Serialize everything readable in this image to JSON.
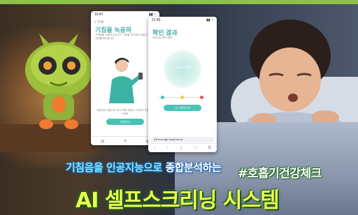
{
  "phone1": {
    "time": "10:47",
    "back_label": "< 뒤로",
    "title": "기침을 녹음하",
    "description": "기침음을 녹음하시면 AI가 기침을 분석하여 호흡기 건강 상태를 확인합니다.",
    "hint": "녹음버튼이 빨간색 으로 바뀌면 녹음이 시작되며 기침을 해주세요.",
    "button_label": "녹음하기"
  },
  "phone2": {
    "time": "21:45",
    "title": "확인 결과",
    "subtitle": "인공지능 확인 결과",
    "circle_label": "기침소리 분석",
    "button_label": "다시 확인하기",
    "url": "aA  ● cough.vixplmed.ai"
  },
  "captions": {
    "line1_highlight": "기침음을 인공지능으로",
    "line1_rest": " 종합분석하는",
    "hashtag": "#호흡기건강체크",
    "line2": "AI 셀프스크리닝 시스템"
  },
  "colors": {
    "accent_teal": "#47c3b4",
    "caption_yellow": "#e9ff4a",
    "indicator_green": "#47c3b4",
    "indicator_yellow": "#f2c94c",
    "indicator_red": "#eb5757"
  }
}
